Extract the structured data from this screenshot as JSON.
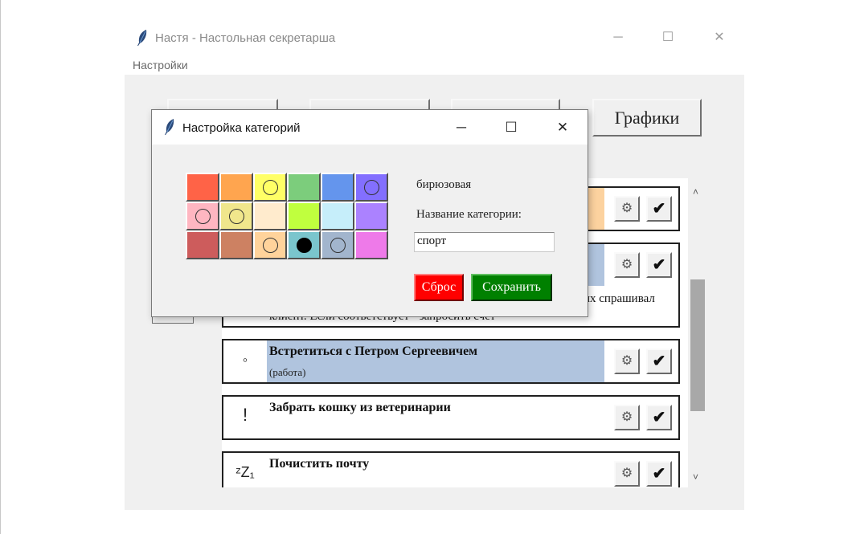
{
  "main_window": {
    "title": "Настя - Настольная секретарша",
    "menu": {
      "settings": "Настройки"
    },
    "toolbar": {
      "graphs_label": "Графики"
    },
    "tasks": [
      {
        "icon": "",
        "title": "",
        "category": "",
        "color": "#fcd29f"
      },
      {
        "icon": "",
        "title": "",
        "category": "",
        "color": "#b0c4de",
        "extra_line1": "их спрашивал",
        "extra_line2": "клиент. Если соответствует - запросить счёт"
      },
      {
        "icon": "◦",
        "title": "Встретиться с Петром Сергеевичем",
        "category": "(работа)",
        "color": "#b0c4de"
      },
      {
        "icon": "!",
        "title": "Забрать кошку из ветеринарии",
        "category": "",
        "color": "#ffffff"
      },
      {
        "icon": "ᶻZ₁",
        "title": "Почистить почту",
        "category": "",
        "color": "#ffffff"
      }
    ],
    "task_buttons": {
      "gear_icon": "gear-icon",
      "check_icon": "check-icon",
      "gear_glyph": "⚙",
      "check_glyph": "✔"
    },
    "scroll": {
      "up": "˄",
      "down": "˅"
    }
  },
  "dialog": {
    "title": "Настройка категорий",
    "window_buttons": {
      "minimize": "─",
      "maximize": "☐",
      "close": "✕"
    },
    "palette": [
      {
        "color": "#ff6347",
        "mark": ""
      },
      {
        "color": "#ffa54f",
        "mark": ""
      },
      {
        "color": "#ffff66",
        "mark": "ring"
      },
      {
        "color": "#7ccd7c",
        "mark": ""
      },
      {
        "color": "#6495ed",
        "mark": ""
      },
      {
        "color": "#836fff",
        "mark": "ring"
      },
      {
        "color": "#ffb6c1",
        "mark": "ring"
      },
      {
        "color": "#f0e68c",
        "mark": "ring"
      },
      {
        "color": "#ffebcd",
        "mark": ""
      },
      {
        "color": "#c0ff3e",
        "mark": ""
      },
      {
        "color": "#c6eefa",
        "mark": ""
      },
      {
        "color": "#ab82ff",
        "mark": ""
      },
      {
        "color": "#cd5c5c",
        "mark": ""
      },
      {
        "color": "#cd8162",
        "mark": ""
      },
      {
        "color": "#ffd39b",
        "mark": "ring"
      },
      {
        "color": "#7ac5cd",
        "mark": "filled"
      },
      {
        "color": "#a2b5cd",
        "mark": "ring"
      },
      {
        "color": "#ee7ae9",
        "mark": ""
      }
    ],
    "selected_color_name": "бирюзовая",
    "name_label": "Название категории:",
    "name_value": "спорт",
    "reset_label": "Сброс",
    "save_label": "Сохранить"
  },
  "app_title_bar": {
    "minimize": "─",
    "maximize": "☐",
    "close": "✕"
  }
}
